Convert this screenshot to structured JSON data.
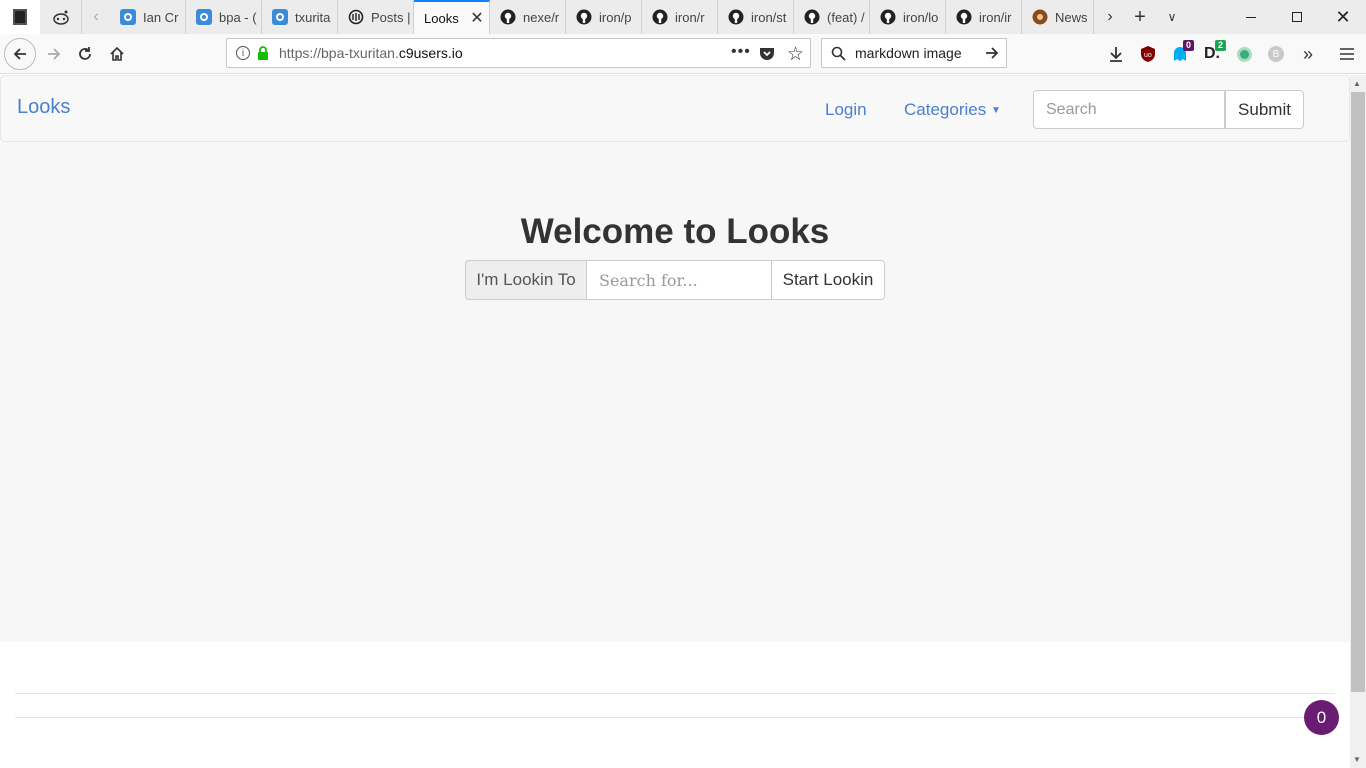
{
  "browser": {
    "tabs": [
      {
        "label": "Ian Cr",
        "icon": "cloud9-icon"
      },
      {
        "label": "bpa - (",
        "icon": "cloud9-icon"
      },
      {
        "label": "txurita",
        "icon": "cloud9-icon"
      },
      {
        "label": "Posts |",
        "icon": "ghost-icon"
      },
      {
        "label": "Looks",
        "icon": "none",
        "active": true
      },
      {
        "label": "nexe/r",
        "icon": "github-icon"
      },
      {
        "label": "iron/p",
        "icon": "github-icon"
      },
      {
        "label": "iron/r",
        "icon": "github-icon"
      },
      {
        "label": "iron/st",
        "icon": "github-icon"
      },
      {
        "label": "(feat) /",
        "icon": "github-icon"
      },
      {
        "label": "iron/lo",
        "icon": "github-icon"
      },
      {
        "label": "iron/ir",
        "icon": "github-icon"
      },
      {
        "label": "News",
        "icon": "rust-icon"
      }
    ],
    "url": {
      "prefix": "https://bpa-txuritan.",
      "domain": "c9users.io"
    },
    "search_value": "markdown image",
    "badges": {
      "ghostery": "0",
      "dashlane": "2"
    }
  },
  "site": {
    "brand": "Looks",
    "nav_login": "Login",
    "nav_categories": "Categories",
    "nav_search_placeholder": "Search",
    "nav_submit": "Submit"
  },
  "hero": {
    "title": "Welcome to Looks",
    "addon_label": "I'm Lookin To",
    "input_placeholder": "Search for...",
    "button_label": "Start Lookin"
  },
  "chat_count": "0",
  "colors": {
    "accent": "#4a7fd1",
    "chat": "#6a1b72",
    "firefox_blue": "#0a84ff"
  }
}
